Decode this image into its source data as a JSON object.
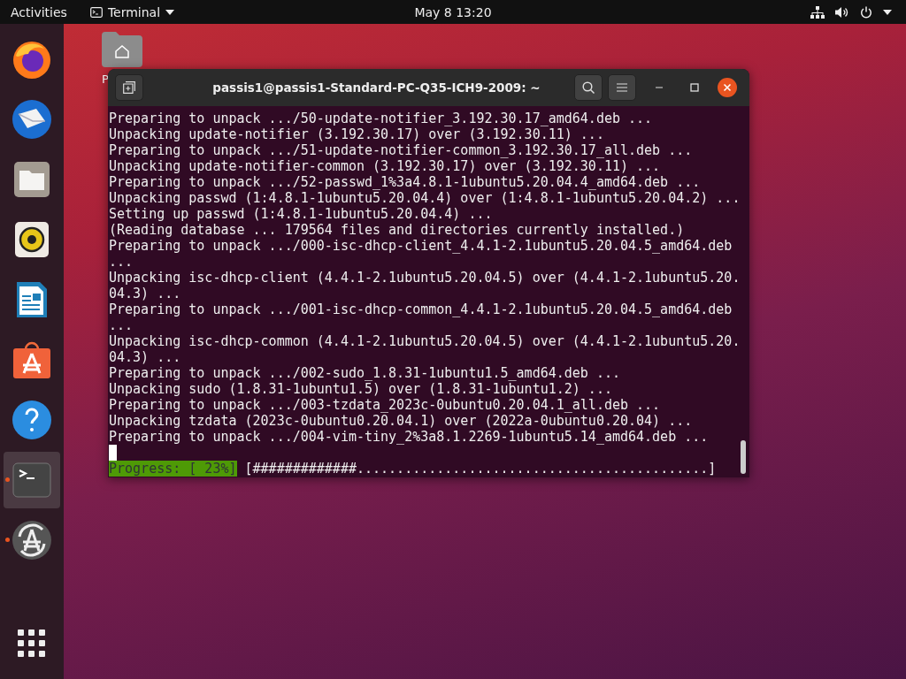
{
  "top_bar": {
    "activities": "Activities",
    "app_menu": "Terminal",
    "clock": "May 8  13:20"
  },
  "dock": [
    {
      "kind": "firefox",
      "running": false,
      "selected": false
    },
    {
      "kind": "mail",
      "running": false,
      "selected": false
    },
    {
      "kind": "files",
      "running": false,
      "selected": false
    },
    {
      "kind": "music",
      "running": false,
      "selected": false
    },
    {
      "kind": "writer",
      "running": false,
      "selected": false
    },
    {
      "kind": "store",
      "running": false,
      "selected": false
    },
    {
      "kind": "help",
      "running": false,
      "selected": false
    },
    {
      "kind": "terminal",
      "running": true,
      "selected": true
    },
    {
      "kind": "updater",
      "running": true,
      "selected": false
    },
    {
      "kind": "grid",
      "running": false,
      "selected": false
    }
  ],
  "desktop": {
    "item_label": "P"
  },
  "window": {
    "title": "passis1@passis1-Standard-PC-Q35-ICH9-2009: ~",
    "lines": [
      "Preparing to unpack .../50-update-notifier_3.192.30.17_amd64.deb ...",
      "Unpacking update-notifier (3.192.30.17) over (3.192.30.11) ...",
      "Preparing to unpack .../51-update-notifier-common_3.192.30.17_all.deb ...",
      "Unpacking update-notifier-common (3.192.30.17) over (3.192.30.11) ...",
      "Preparing to unpack .../52-passwd_1%3a4.8.1-1ubuntu5.20.04.4_amd64.deb ...",
      "Unpacking passwd (1:4.8.1-1ubuntu5.20.04.4) over (1:4.8.1-1ubuntu5.20.04.2) ...",
      "Setting up passwd (1:4.8.1-1ubuntu5.20.04.4) ...",
      "(Reading database ... 179564 files and directories currently installed.)",
      "Preparing to unpack .../000-isc-dhcp-client_4.4.1-2.1ubuntu5.20.04.5_amd64.deb",
      "...",
      "Unpacking isc-dhcp-client (4.4.1-2.1ubuntu5.20.04.5) over (4.4.1-2.1ubuntu5.20.",
      "04.3) ...",
      "Preparing to unpack .../001-isc-dhcp-common_4.4.1-2.1ubuntu5.20.04.5_amd64.deb",
      "...",
      "Unpacking isc-dhcp-common (4.4.1-2.1ubuntu5.20.04.5) over (4.4.1-2.1ubuntu5.20.",
      "04.3) ...",
      "Preparing to unpack .../002-sudo_1.8.31-1ubuntu1.5_amd64.deb ...",
      "Unpacking sudo (1.8.31-1ubuntu1.5) over (1.8.31-1ubuntu1.2) ...",
      "Preparing to unpack .../003-tzdata_2023c-0ubuntu0.20.04.1_all.deb ...",
      "Unpacking tzdata (2023c-0ubuntu0.20.04.1) over (2022a-0ubuntu0.20.04) ...",
      "Preparing to unpack .../004-vim-tiny_2%3a8.1.2269-1ubuntu5.14_amd64.deb ..."
    ],
    "progress_label": "Progress: [ 23%]",
    "progress_bar": "[#############............................................]"
  }
}
